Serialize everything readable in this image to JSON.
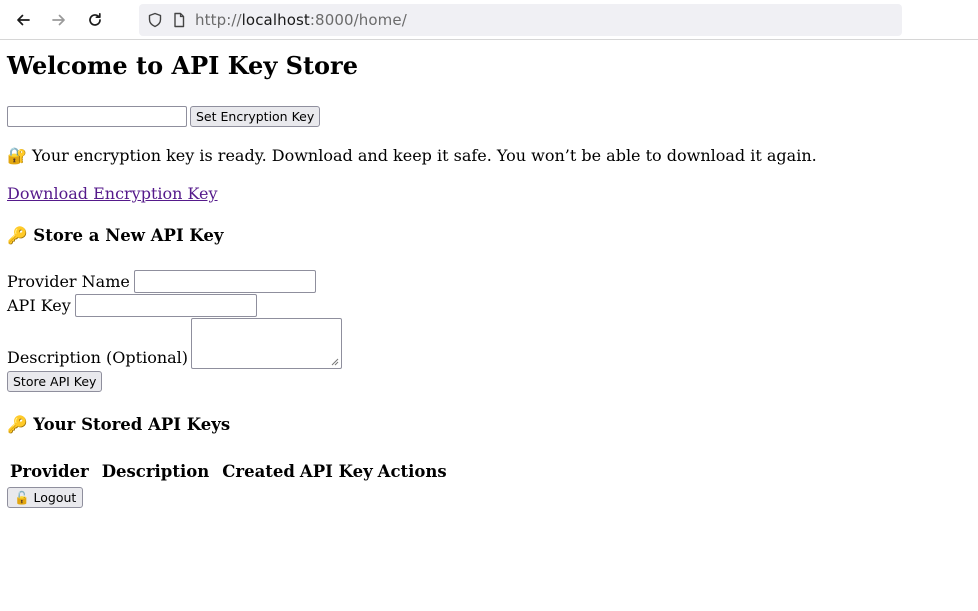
{
  "browser": {
    "url_prefix": "http://",
    "url_host": "localhost",
    "url_rest": ":8000/home/"
  },
  "page": {
    "title": "Welcome to API Key Store",
    "encryption": {
      "input_value": "",
      "set_button": "Set Encryption Key"
    },
    "notice": "🔐 Your encryption key is ready. Download and keep it safe. You won’t be able to download it again.",
    "download_link": "Download Encryption Key",
    "store_section": {
      "heading": "🔑 Store a New API Key",
      "provider_label": "Provider Name",
      "api_key_label": "API Key",
      "description_label": "Description (Optional)",
      "store_button": "Store API Key"
    },
    "stored_section": {
      "heading": "🔑 Your Stored API Keys",
      "columns": [
        "Provider",
        "Description",
        "Created",
        "API Key",
        "Actions"
      ]
    },
    "logout_button": "🔓 Logout"
  }
}
